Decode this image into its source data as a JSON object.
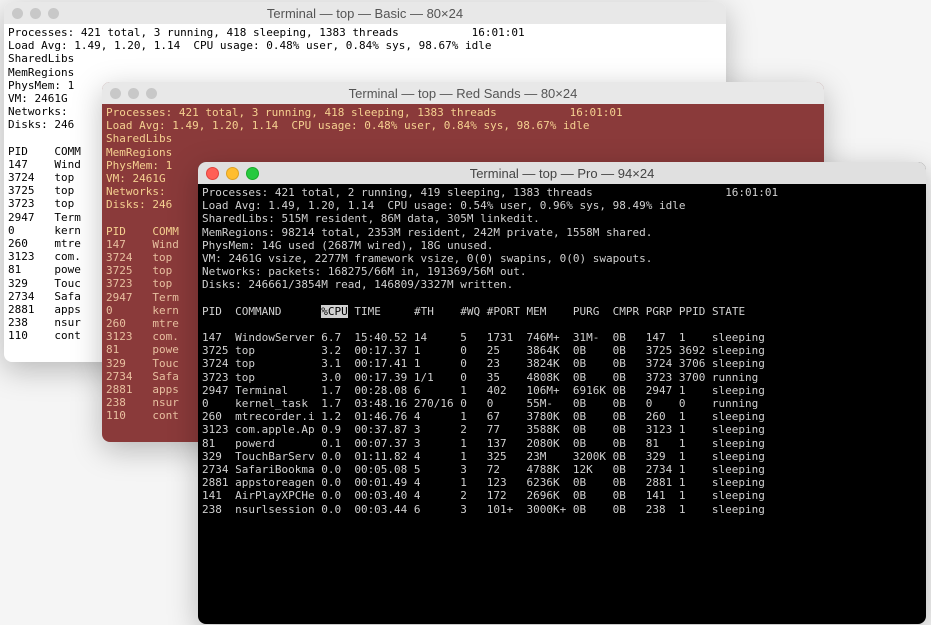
{
  "windows": {
    "basic": {
      "title": "Terminal — top — Basic — 80×24",
      "time": "16:01:01",
      "processes_line": "Processes: 421 total, 3 running, 418 sleeping, 1383 threads",
      "load_line": "Load Avg: 1.49, 1.20, 1.14  CPU usage: 0.48% user, 0.84% sys, 98.67% idle",
      "sharedlibs": "SharedLibs",
      "memregions": "MemRegions",
      "physmem": "PhysMem: 1",
      "vm": "VM: 2461G",
      "networks": "Networks:",
      "disks": "Disks: 246",
      "header": "PID    COMM",
      "rows": [
        "147    Wind",
        "3724   top",
        "3725   top",
        "3723   top",
        "2947   Term",
        "0      kern",
        "260    mtre",
        "3123   com.",
        "81     powe",
        "329    Touc",
        "2734   Safa",
        "2881   apps",
        "238    nsur",
        "110    cont"
      ]
    },
    "red": {
      "title": "Terminal — top — Red Sands — 80×24",
      "time": "16:01:01",
      "processes_line": "Processes: 421 total, 3 running, 418 sleeping, 1383 threads",
      "load_line": "Load Avg: 1.49, 1.20, 1.14  CPU usage: 0.48% user, 0.84% sys, 98.67% idle",
      "sharedlibs": "SharedLibs",
      "memregions": "MemRegions",
      "physmem": "PhysMem: 1",
      "vm": "VM: 2461G",
      "networks": "Networks:",
      "disks": "Disks: 246",
      "header": "PID    COMM",
      "rows": [
        "147    Wind",
        "3724   top",
        "3725   top",
        "3723   top",
        "2947   Term",
        "0      kern",
        "260    mtre",
        "3123   com.",
        "81     powe",
        "329    Touc",
        "2734   Safa",
        "2881   apps",
        "238    nsur",
        "110    cont"
      ]
    },
    "pro": {
      "title": "Terminal — top — Pro — 94×24",
      "time": "16:01:01",
      "processes_line": "Processes: 421 total, 2 running, 419 sleeping, 1383 threads",
      "load_line": "Load Avg: 1.49, 1.20, 1.14  CPU usage: 0.54% user, 0.96% sys, 98.49% idle",
      "sharedlibs": "SharedLibs: 515M resident, 86M data, 305M linkedit.",
      "memregions": "MemRegions: 98214 total, 2353M resident, 242M private, 1558M shared.",
      "physmem": "PhysMem: 14G used (2687M wired), 18G unused.",
      "vm": "VM: 2461G vsize, 2277M framework vsize, 0(0) swapins, 0(0) swapouts.",
      "networks": "Networks: packets: 168275/66M in, 191369/56M out.",
      "disks": "Disks: 246661/3854M read, 146809/3327M written.",
      "cols": [
        "PID",
        "COMMAND",
        "%CPU",
        "TIME",
        "#TH",
        "#WQ",
        "#PORT",
        "MEM",
        "PURG",
        "CMPR",
        "PGRP",
        "PPID",
        "STATE"
      ],
      "rows": [
        [
          "147",
          "WindowServer",
          "6.7",
          "15:40.52",
          "14",
          "5",
          "1731",
          "746M+",
          "31M-",
          "0B",
          "147",
          "1",
          "sleeping"
        ],
        [
          "3725",
          "top",
          "3.2",
          "00:17.37",
          "1",
          "0",
          "25",
          "3864K",
          "0B",
          "0B",
          "3725",
          "3692",
          "sleeping"
        ],
        [
          "3724",
          "top",
          "3.1",
          "00:17.41",
          "1",
          "0",
          "23",
          "3824K",
          "0B",
          "0B",
          "3724",
          "3706",
          "sleeping"
        ],
        [
          "3723",
          "top",
          "3.0",
          "00:17.39",
          "1/1",
          "0",
          "35",
          "4808K",
          "0B",
          "0B",
          "3723",
          "3700",
          "running"
        ],
        [
          "2947",
          "Terminal",
          "1.7",
          "00:28.08",
          "6",
          "1",
          "402",
          "106M+",
          "6916K",
          "0B",
          "2947",
          "1",
          "sleeping"
        ],
        [
          "0",
          "kernel_task",
          "1.7",
          "03:48.16",
          "270/16",
          "0",
          "0",
          "55M-",
          "0B",
          "0B",
          "0",
          "0",
          "running"
        ],
        [
          "260",
          "mtrecorder.i",
          "1.2",
          "01:46.76",
          "4",
          "1",
          "67",
          "3780K",
          "0B",
          "0B",
          "260",
          "1",
          "sleeping"
        ],
        [
          "3123",
          "com.apple.Ap",
          "0.9",
          "00:37.87",
          "3",
          "2",
          "77",
          "3588K",
          "0B",
          "0B",
          "3123",
          "1",
          "sleeping"
        ],
        [
          "81",
          "powerd",
          "0.1",
          "00:07.37",
          "3",
          "1",
          "137",
          "2080K",
          "0B",
          "0B",
          "81",
          "1",
          "sleeping"
        ],
        [
          "329",
          "TouchBarServ",
          "0.0",
          "01:11.82",
          "4",
          "1",
          "325",
          "23M",
          "3200K",
          "0B",
          "329",
          "1",
          "sleeping"
        ],
        [
          "2734",
          "SafariBookma",
          "0.0",
          "00:05.08",
          "5",
          "3",
          "72",
          "4788K",
          "12K",
          "0B",
          "2734",
          "1",
          "sleeping"
        ],
        [
          "2881",
          "appstoreagen",
          "0.0",
          "00:01.49",
          "4",
          "1",
          "123",
          "6236K",
          "0B",
          "0B",
          "2881",
          "1",
          "sleeping"
        ],
        [
          "141",
          "AirPlayXPCHe",
          "0.0",
          "00:03.40",
          "4",
          "2",
          "172",
          "2696K",
          "0B",
          "0B",
          "141",
          "1",
          "sleeping"
        ],
        [
          "238",
          "nsurlsession",
          "0.0",
          "00:03.44",
          "6",
          "3",
          "101+",
          "3000K+",
          "0B",
          "0B",
          "238",
          "1",
          "sleeping"
        ]
      ]
    }
  },
  "icons": {
    "close": "close-icon",
    "min": "minimize-icon",
    "max": "maximize-icon"
  }
}
